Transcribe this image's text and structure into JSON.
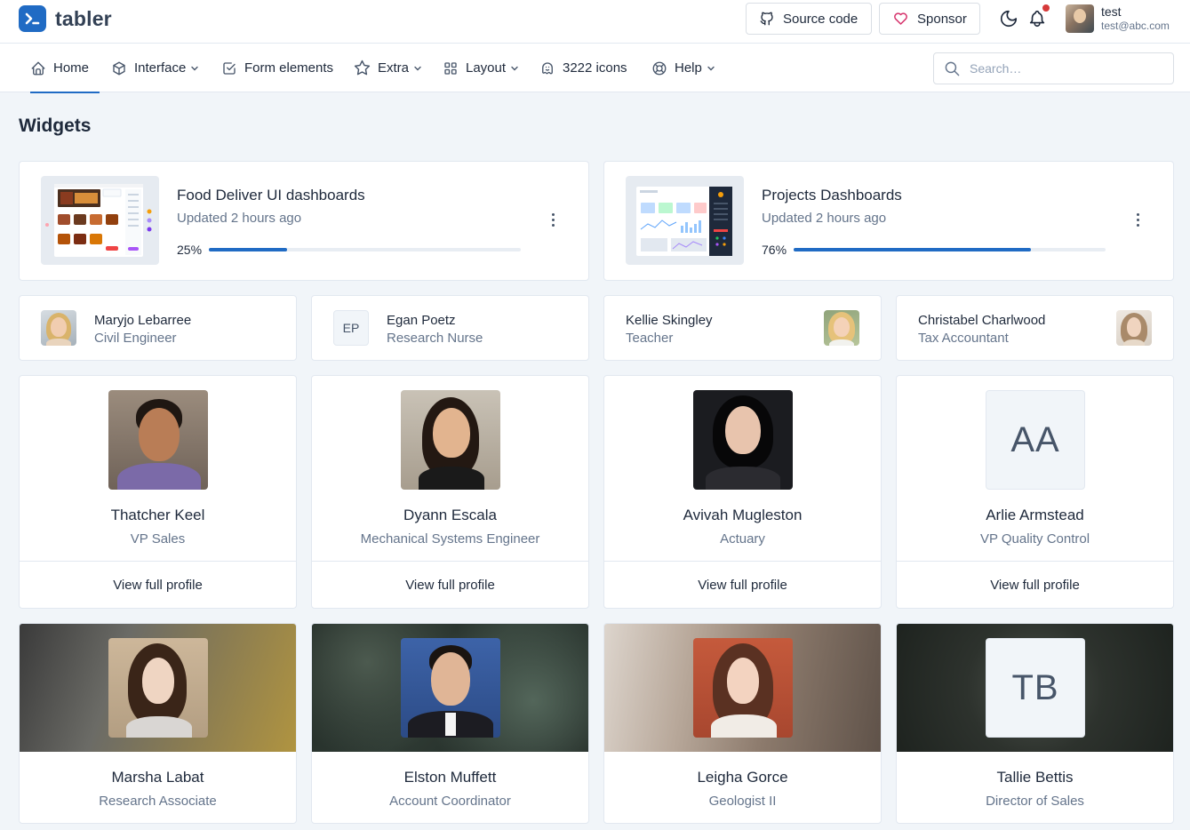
{
  "brand": {
    "name": "tabler"
  },
  "header": {
    "source_code_label": "Source code",
    "sponsor_label": "Sponsor",
    "user": {
      "name": "test",
      "email": "test@abc.com"
    }
  },
  "nav": {
    "items": [
      {
        "label": "Home",
        "icon": "home-icon"
      },
      {
        "label": "Interface",
        "icon": "package-icon"
      },
      {
        "label": "Form elements",
        "icon": "checkbox-icon"
      },
      {
        "label": "Extra",
        "icon": "star-icon"
      },
      {
        "label": "Layout",
        "icon": "layout-grid-icon"
      },
      {
        "label": "3222 icons",
        "icon": "ghost-icon"
      },
      {
        "label": "Help",
        "icon": "lifebuoy-icon"
      }
    ],
    "search_placeholder": "Search…"
  },
  "page": {
    "title": "Widgets"
  },
  "dashboards": [
    {
      "title": "Food Deliver UI dashboards",
      "updated": "Updated 2 hours ago",
      "progress_label": "25%",
      "progress": 25
    },
    {
      "title": "Projects Dashboards",
      "updated": "Updated 2 hours ago",
      "progress_label": "76%",
      "progress": 76
    }
  ],
  "people": [
    {
      "name": "Maryjo Lebarree",
      "role": "Civil Engineer"
    },
    {
      "name": "Egan Poetz",
      "role": "Research Nurse",
      "initials": "EP"
    },
    {
      "name": "Kellie Skingley",
      "role": "Teacher"
    },
    {
      "name": "Christabel Charlwood",
      "role": "Tax Accountant"
    }
  ],
  "profiles": [
    {
      "name": "Thatcher Keel",
      "role": "VP Sales",
      "action": "View full profile"
    },
    {
      "name": "Dyann Escala",
      "role": "Mechanical Systems Engineer",
      "action": "View full profile"
    },
    {
      "name": "Avivah Mugleston",
      "role": "Actuary",
      "action": "View full profile"
    },
    {
      "name": "Arlie Armstead",
      "role": "VP Quality Control",
      "action": "View full profile",
      "initials": "AA"
    }
  ],
  "covers": [
    {
      "name": "Marsha Labat",
      "role": "Research Associate"
    },
    {
      "name": "Elston Muffett",
      "role": "Account Coordinator"
    },
    {
      "name": "Leigha Gorce",
      "role": "Geologist II"
    },
    {
      "name": "Tallie Bettis",
      "role": "Director of Sales",
      "initials": "TB"
    }
  ],
  "colors": {
    "primary": "#206bc4",
    "page_bg": "#f1f5f9",
    "text_muted": "#64748b",
    "notification": "#d63939"
  }
}
